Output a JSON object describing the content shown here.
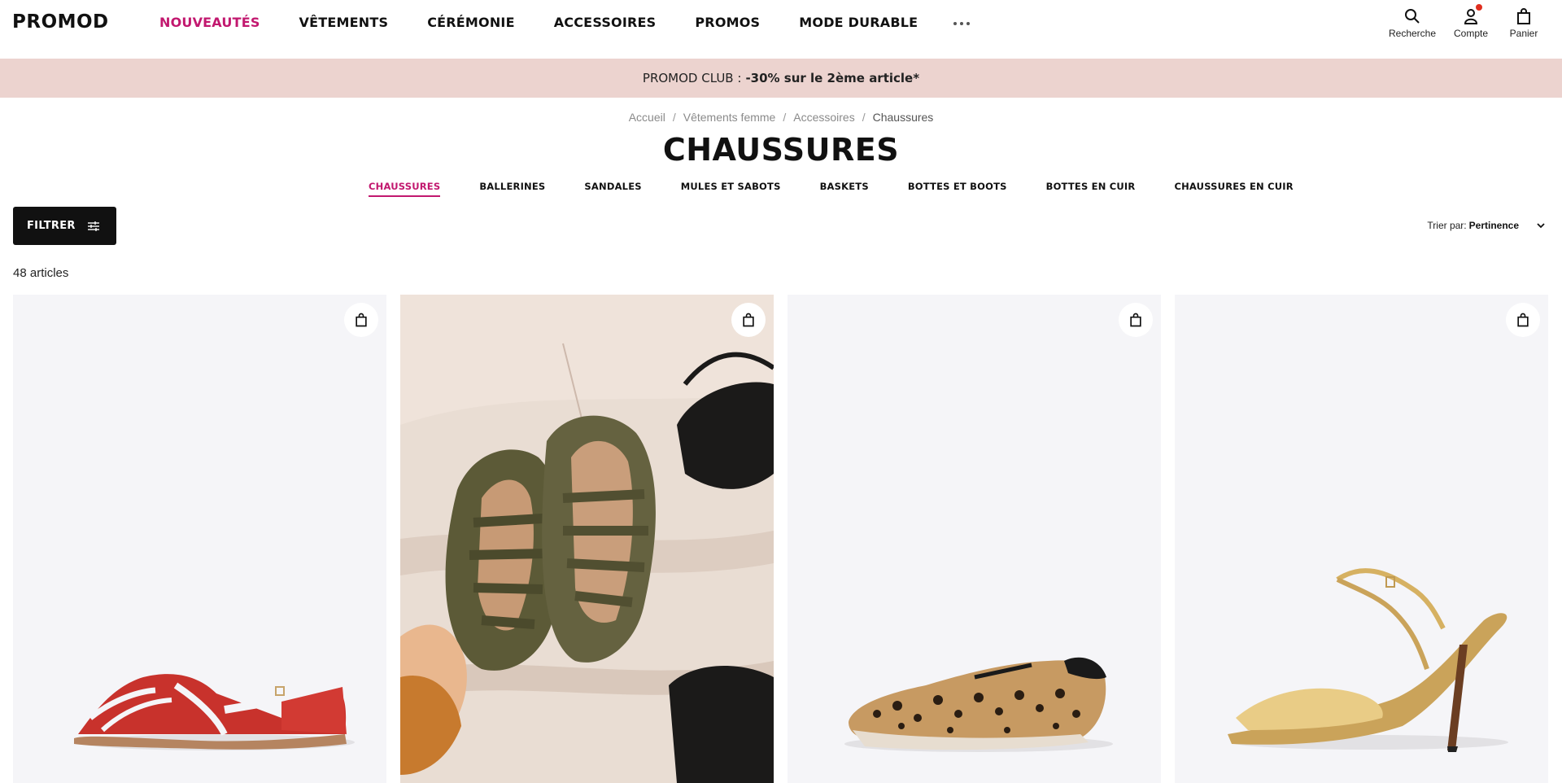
{
  "header": {
    "logo": "PROMOD",
    "nav": [
      {
        "label": "NOUVEAUTÉS",
        "active": true
      },
      {
        "label": "VÊTEMENTS",
        "active": false
      },
      {
        "label": "CÉRÉMONIE",
        "active": false
      },
      {
        "label": "ACCESSOIRES",
        "active": false
      },
      {
        "label": "PROMOS",
        "active": false
      },
      {
        "label": "MODE DURABLE",
        "active": false
      }
    ],
    "tools": {
      "search": "Recherche",
      "account": "Compte",
      "cart": "Panier"
    }
  },
  "promo": {
    "prefix": "PROMOD CLUB :",
    "highlight": "-30% sur le 2ème article*"
  },
  "breadcrumb": [
    "Accueil",
    "Vêtements femme",
    "Accessoires",
    "Chaussures"
  ],
  "page_title": "CHAUSSURES",
  "subcategories": [
    {
      "label": "CHAUSSURES",
      "active": true
    },
    {
      "label": "BALLERINES",
      "active": false
    },
    {
      "label": "SANDALES",
      "active": false
    },
    {
      "label": "MULES ET SABOTS",
      "active": false
    },
    {
      "label": "BASKETS",
      "active": false
    },
    {
      "label": "BOTTES ET BOOTS",
      "active": false
    },
    {
      "label": "BOTTES EN CUIR",
      "active": false
    },
    {
      "label": "CHAUSSURES EN CUIR",
      "active": false
    }
  ],
  "toolbar": {
    "filter_label": "FILTRER",
    "sort_prefix": "Trier par:",
    "sort_value": "Pertinence"
  },
  "results_count": "48 articles",
  "products": [
    {
      "image": "red-fisherman-sandal"
    },
    {
      "image": "khaki-fisherman-sandals-lifestyle"
    },
    {
      "image": "leopard-sneaker"
    },
    {
      "image": "gold-heeled-sandal"
    }
  ],
  "colors": {
    "accent": "#c2186f",
    "promo_bg": "#ecd3cf",
    "notification": "#e02e1f",
    "card_bg": "#f5f5f8"
  }
}
